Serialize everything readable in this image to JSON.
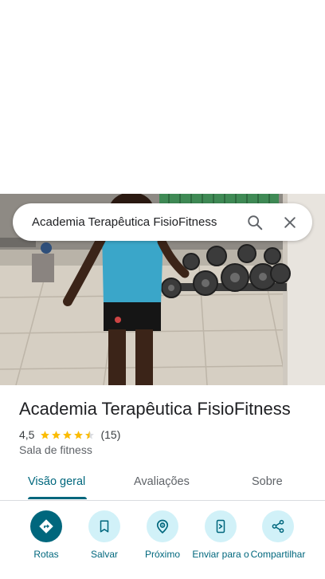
{
  "search": {
    "query": "Academia Terapêutica FisioFitness",
    "search_icon": "search-icon",
    "close_icon": "close-icon"
  },
  "photo": {
    "subject": "gym-photo"
  },
  "place": {
    "name": "Academia Terapêutica FisioFitness",
    "rating": "4,5",
    "rating_value": 4.5,
    "reviews": "(15)",
    "category": "Sala de fitness"
  },
  "tabs": [
    {
      "label": "Visão geral",
      "active": true
    },
    {
      "label": "Avaliações",
      "active": false
    },
    {
      "label": "Sobre",
      "active": false
    }
  ],
  "actions": [
    {
      "label": "Rotas",
      "icon": "directions-icon"
    },
    {
      "label": "Salvar",
      "icon": "bookmark-icon"
    },
    {
      "label": "Próximo",
      "icon": "nearby-icon"
    },
    {
      "label": "Enviar para o",
      "icon": "send-to-phone-icon"
    },
    {
      "label": "Compartilhar",
      "icon": "share-icon"
    }
  ],
  "colors": {
    "accent": "#00677d",
    "accent_light": "#d1f1f8",
    "star": "#fbbc04",
    "text_primary": "#202124",
    "text_secondary": "#5f6368"
  }
}
